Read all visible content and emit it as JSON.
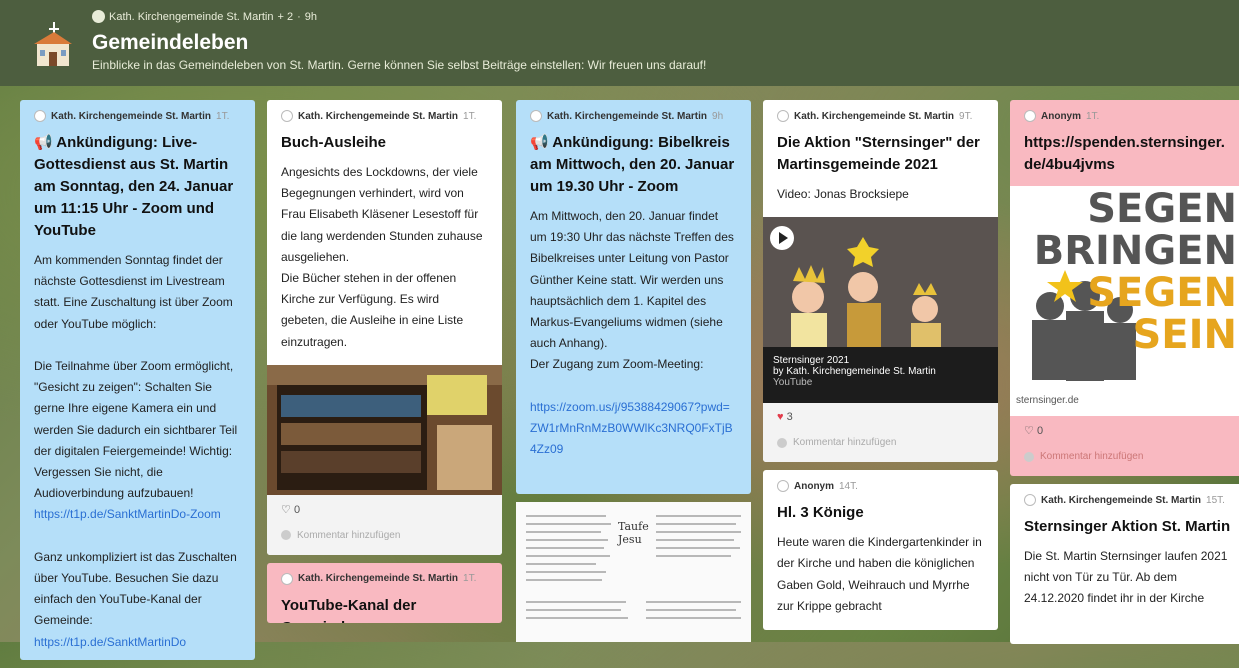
{
  "header": {
    "author": "Kath. Kirchengemeinde St. Martin",
    "contributors": "+ 2",
    "separator": "·",
    "time": "9h",
    "title": "Gemeindeleben",
    "subtitle": "Einblicke in das Gemeindeleben von St. Martin. Gerne können Sie selbst Beiträge einstellen: Wir freuen uns darauf!"
  },
  "colors": {
    "header": "#4d5e3f",
    "blue": "#b5dff9",
    "pink": "#f9b9c1",
    "link": "#2a6fd3"
  },
  "posts": {
    "p1": {
      "author": "Kath. Kirchengemeinde St. Martin",
      "time": "1T.",
      "title": "📢 Ankündigung: Live-Gottesdienst aus St. Martin am Sonntag, den 24. Januar um 11:15 Uhr - Zoom und YouTube",
      "text1": "Am kommenden Sonntag findet der nächste Gottesdienst im Livestream statt. Eine Zuschaltung ist über Zoom oder YouTube möglich:\n\nDie Teilnahme über Zoom ermöglicht, \"Gesicht zu zeigen\": Schalten Sie gerne Ihre eigene Kamera ein und werden Sie dadurch ein sichtbarer Teil der digitalen Feiergemeinde! Wichtig: Vergessen Sie nicht, die Audioverbindung aufzubauen!",
      "link1": "https://t1p.de/SanktMartinDo-Zoom",
      "text2": "Ganz unkompliziert ist das Zuschalten über YouTube. Besuchen Sie dazu einfach den YouTube-Kanal der Gemeinde:",
      "link2": "https://t1p.de/SanktMartinDo"
    },
    "p2": {
      "author": "Kath. Kirchengemeinde St. Martin",
      "time": "1T.",
      "title": "Buch-Ausleihe",
      "text": "Angesichts des Lockdowns, der viele Begegnungen verhindert, wird von Frau Elisabeth Kläsener Lesestoff für die lang werdenden Stunden zuhause ausgeliehen.\nDie Bücher stehen in der offenen Kirche zur Verfügung. Es wird gebeten, die Ausleihe in eine Liste einzutragen.",
      "likes": "0",
      "comment": "Kommentar hinzufügen"
    },
    "p3": {
      "author": "Kath. Kirchengemeinde St. Martin",
      "time": "1T.",
      "title": "YouTube-Kanal der Gemeinde"
    },
    "p4": {
      "author": "Kath. Kirchengemeinde St. Martin",
      "time": "9h",
      "title": "📢 Ankündigung: Bibelkreis am Mittwoch, den 20. Januar um 19.30 Uhr - Zoom",
      "text": "Am Mittwoch, den 20. Januar findet um 19:30 Uhr das nächste Treffen des Bibelkreises unter Leitung von Pastor Günther Keine statt. Wir werden uns hauptsächlich dem 1. Kapitel des Markus-Evangeliums widmen (siehe auch Anhang).\nDer Zugang zum Zoom-Meeting:",
      "link": "https://zoom.us/j/95388429067?pwd=ZW1rMnRnMzB0WWlKc3NRQ0FxTjB4Zz09",
      "attachment_label": "Taufe Jesu"
    },
    "p5": {
      "author": "Kath. Kirchengemeinde St. Martin",
      "time": "9T.",
      "title": "Die Aktion \"Sternsinger\" der Martinsgemeinde 2021",
      "text": "Video: Jonas Brocksiepe",
      "video_title": "Sternsinger 2021",
      "video_by": "by Kath. Kirchengemeinde St. Martin",
      "video_source": "YouTube",
      "likes": "3",
      "comment": "Kommentar hinzufügen"
    },
    "p6": {
      "author": "Anonym",
      "time": "14T.",
      "title": "Hl. 3 Könige",
      "text": "Heute waren die Kindergartenkinder in der Kirche und haben die königlichen Gaben Gold, Weihrauch und Myrrhe zur Krippe gebracht"
    },
    "p7": {
      "author": "Anonym",
      "time": "1T.",
      "title": "https://spenden.sternsinger.de/4bu4jvms",
      "logo_line1": "SEGEN",
      "logo_line2": "BRINGEN",
      "logo_line3": "SEGEN",
      "logo_line4": "SEIN",
      "logo_site": "sternsinger.de",
      "likes": "0",
      "comment": "Kommentar hinzufügen"
    },
    "p8": {
      "author": "Kath. Kirchengemeinde St. Martin",
      "time": "15T.",
      "title": "Sternsinger Aktion St. Martin",
      "text": "Die St. Martin Sternsinger laufen 2021 nicht von Tür zu Tür. Ab dem 24.12.2020 findet ihr in der Kirche"
    }
  }
}
